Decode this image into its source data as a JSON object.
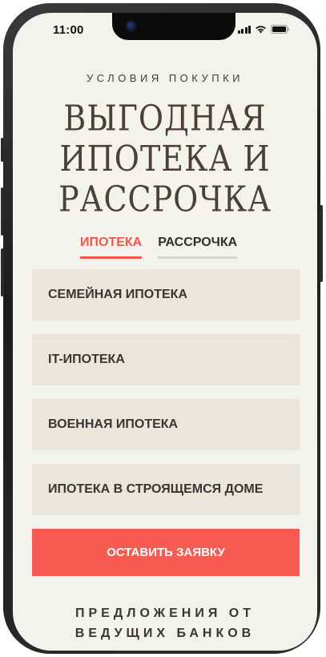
{
  "status_bar": {
    "time": "11:00"
  },
  "page": {
    "subtitle": "УСЛОВИЯ ПОКУПКИ",
    "heading_lines": [
      "ВЫГОДНАЯ",
      "ИПОТЕКА И",
      "РАССРОЧКА"
    ]
  },
  "tabs": [
    {
      "label": "ИПОТЕКА",
      "active": true
    },
    {
      "label": "РАССРОЧКА",
      "active": false
    }
  ],
  "options": [
    {
      "label": "СЕМЕЙНАЯ ИПОТЕКА"
    },
    {
      "label": "IT-ИПОТЕКА"
    },
    {
      "label": "ВОЕННАЯ ИПОТЕКА"
    },
    {
      "label": "ИПОТЕКА В СТРОЯЩЕМСЯ ДОМЕ"
    }
  ],
  "cta": {
    "label": "ОСТАВИТЬ ЗАЯВКУ"
  },
  "footer": {
    "lines": [
      "ПРЕДЛОЖЕНИЯ ОТ",
      "ВЕДУЩИХ БАНКОВ"
    ]
  },
  "colors": {
    "accent": "#f65a50",
    "screen_bg": "#f3f2ec",
    "card_bg": "#e9e6db",
    "heading": "#4b3f36"
  },
  "icons": [
    "signal-icon",
    "wifi-icon",
    "battery-icon",
    "camera-icon"
  ]
}
